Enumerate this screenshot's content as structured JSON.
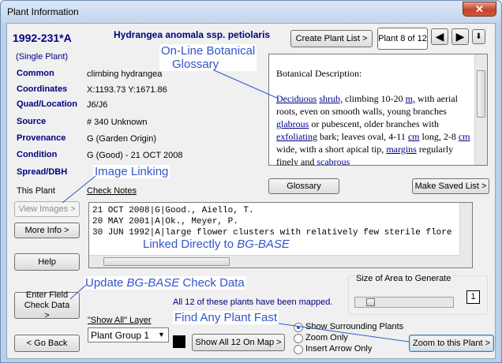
{
  "window": {
    "title": "Plant Information",
    "close_glyph": "✕"
  },
  "plant": {
    "accession": "1992-231*A",
    "name": "Hydrangea anomala ssp. petiolaris",
    "plant_type": "(Single Plant)",
    "common_label": "Common",
    "common_value": "climbing hydrangea",
    "coords_label": "Coordinates",
    "coords_value": "X:1193.73  Y:1671.86",
    "quad_label": "Quad/Location",
    "quad_value": "J6/J6",
    "source_label": "Source",
    "source_value": "# 340  Unknown",
    "prov_label": "Provenance",
    "prov_value": "G (Garden Origin)",
    "cond_label": "Condition",
    "cond_value": "G (Good)  -  21 OCT 2008",
    "spread_label": "Spread/DBH"
  },
  "toolbar": {
    "create_plant_list": "Create Plant List >",
    "plant_counter": "Plant 8 of 12",
    "prev_icon": "◀",
    "next_icon": "▶",
    "down_icon": "⬇"
  },
  "description": {
    "heading": "Botanical Description:",
    "segments": [
      {
        "t": "Deciduous",
        "link": true
      },
      {
        "t": " ",
        "link": false
      },
      {
        "t": "shrub,",
        "link": true
      },
      {
        "t": " climbing 10-20 ",
        "link": false
      },
      {
        "t": "m,",
        "link": true
      },
      {
        "t": " with aerial roots, even on smooth walls, young branches ",
        "link": false
      },
      {
        "t": "glabrous",
        "link": true
      },
      {
        "t": " or pubescent, older branches with ",
        "link": false
      },
      {
        "t": "exfoliating",
        "link": true
      },
      {
        "t": " bark; leaves oval, 4-11 ",
        "link": false
      },
      {
        "t": "cm",
        "link": true
      },
      {
        "t": " long, 2-8 ",
        "link": false
      },
      {
        "t": "cm",
        "link": true
      },
      {
        "t": " wide, with a short apical tip, ",
        "link": false
      },
      {
        "t": "margins",
        "link": true
      },
      {
        "t": " regularly finely and ",
        "link": false
      },
      {
        "t": "scabrous",
        "link": true
      }
    ]
  },
  "buttons": {
    "glossary": "Glossary",
    "make_saved_list": "Make Saved List >",
    "view_images": "View Images >",
    "more_info": "More Info >",
    "help": "Help",
    "enter_field_check": "Enter Field Check Data >",
    "go_back": "< Go Back",
    "show_all": "Show All 12 On Map >",
    "zoom_to_plant": "Zoom to this Plant >"
  },
  "labels": {
    "this_plant": "This Plant",
    "check_notes": "Check Notes",
    "size_area": "Size of Area to Generate",
    "size_value": "1",
    "mapped_msg": "All 12 of these plants have been mapped.",
    "show_all_layer": "\"Show All\" Layer"
  },
  "check_notes": [
    "21 OCT 2008|G|Good., Aiello, T.",
    "20 MAY 2001|A|Ok., Meyer, P.",
    "30 JUN 1992|A|large flower clusters with relatively few sterile flore"
  ],
  "layer_select": {
    "value": "Plant Group 1"
  },
  "radio_options": [
    {
      "label": "Show Surrounding Plants",
      "checked": true
    },
    {
      "label": "Zoom Only",
      "checked": false
    },
    {
      "label": "Insert Arrow Only",
      "checked": false
    }
  ],
  "annotations": {
    "glossary_a": "On-Line Botanical",
    "glossary_b": "Glossary",
    "image_linking": "Image Linking",
    "linked_pre": "Linked Directly to ",
    "linked_em": "BG-BASE",
    "update_pre": "Update ",
    "update_em": "BG-BASE",
    "update_post": " Check Data",
    "find_any": "Find Any Plant Fast"
  },
  "colors": {
    "annotation": "#3355cc",
    "label": "#000080",
    "link": "#00008b"
  }
}
